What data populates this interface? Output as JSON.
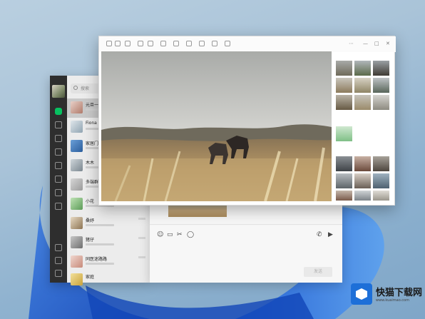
{
  "wechat": {
    "search_placeholder": "搜索",
    "chats": [
      {
        "name": "元旦一"
      },
      {
        "name": "Fiona"
      },
      {
        "name": "家居门"
      },
      {
        "name": "木木"
      },
      {
        "name": "多端群"
      },
      {
        "name": "小花"
      },
      {
        "name": "桑妤"
      },
      {
        "name": "猪仔"
      },
      {
        "name": "同医迷路路"
      },
      {
        "name": "家庭"
      }
    ]
  },
  "compose": {
    "send_label": "发送"
  },
  "viewer": {
    "photo_alt": "field-with-horses-photo"
  },
  "badge": {
    "name": "快猫下载网",
    "url": "www.kuaimao.com"
  }
}
